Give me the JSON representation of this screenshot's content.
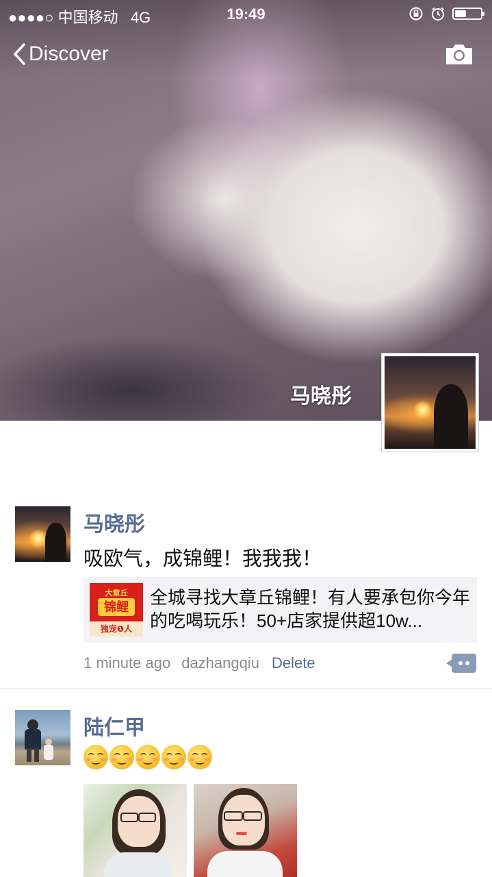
{
  "status_bar": {
    "signal": "●●●●○",
    "carrier": "中国移动",
    "network": "4G",
    "time": "19:49",
    "battery_level": 0.4
  },
  "nav": {
    "back_label": "Discover",
    "camera_icon": "camera-icon"
  },
  "cover": {
    "owner_name": "马晓彤"
  },
  "posts": [
    {
      "author": "马晓彤",
      "text": "吸欧气，成锦鲤！我我我！",
      "link": {
        "title": "全城寻找大章丘锦鲤！有人要承包你今年的吃喝玩乐！50+店家提供超10w...",
        "thumb_top": "大章丘",
        "thumb_main": "锦鲤",
        "thumb_bottom": "独宠❶人"
      },
      "time": "1 minute ago",
      "source": "dazhangqiu",
      "delete_label": "Delete"
    },
    {
      "author": "陆仁甲",
      "emoji_count": 5
    }
  ],
  "colors": {
    "name_blue": "#576b95",
    "meta_gray": "#8a8a8a",
    "link_bg": "#f3f3f5"
  }
}
